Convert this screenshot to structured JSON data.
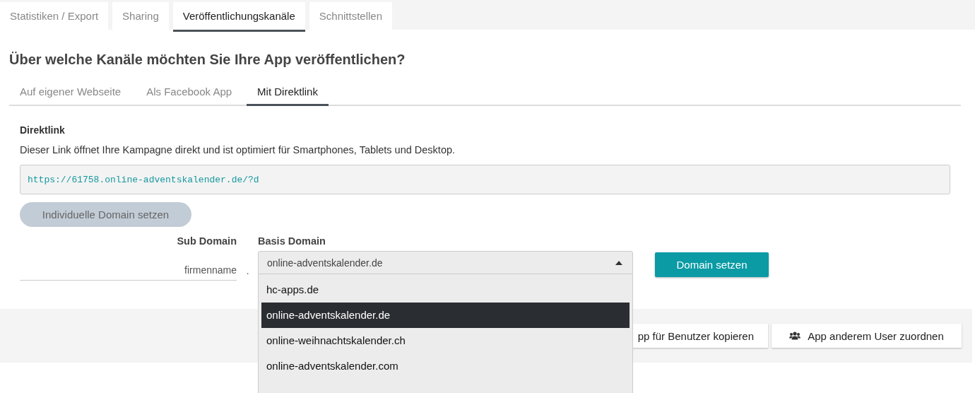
{
  "tabs": [
    {
      "label": "Statistiken / Export",
      "selected": false
    },
    {
      "label": "Sharing",
      "selected": false
    },
    {
      "label": "Veröffentlichungskanäle",
      "selected": true
    },
    {
      "label": "Schnittstellen",
      "selected": false
    }
  ],
  "heading": "Über welche Kanäle möchten Sie Ihre App veröffentlichen?",
  "channel_tabs": [
    {
      "label": "Auf eigener Webseite",
      "selected": false
    },
    {
      "label": "Als Facebook App",
      "selected": false
    },
    {
      "label": "Mit Direktlink",
      "selected": true
    }
  ],
  "direktlink": {
    "title": "Direktlink",
    "description": "Dieser Link öffnet Ihre Kampagne direkt und ist optimiert für Smartphones, Tablets und Desktop.",
    "url": "https://61758.online-adventskalender.de/?d",
    "custom_domain_button": "Individuelle Domain setzen",
    "custom_domain_disabled": true
  },
  "domain_form": {
    "sub_label": "Sub Domain",
    "sub_placeholder": "firmenname",
    "separator": ".",
    "base_label": "Basis Domain",
    "base_value": "online-adventskalender.de",
    "expanded": true,
    "options": [
      {
        "label": "hc-apps.de",
        "selected": false
      },
      {
        "label": "online-adventskalender.de",
        "selected": true
      },
      {
        "label": "online-weihnachtskalender.ch",
        "selected": false
      },
      {
        "label": "online-adventskalender.com",
        "selected": false
      }
    ],
    "submit": "Domain setzen"
  },
  "footer_buttons": [
    {
      "label": "pp für Benutzer kopieren",
      "kind": "plain"
    },
    {
      "label": "App anderem User zuordnen",
      "kind": "users"
    }
  ]
}
